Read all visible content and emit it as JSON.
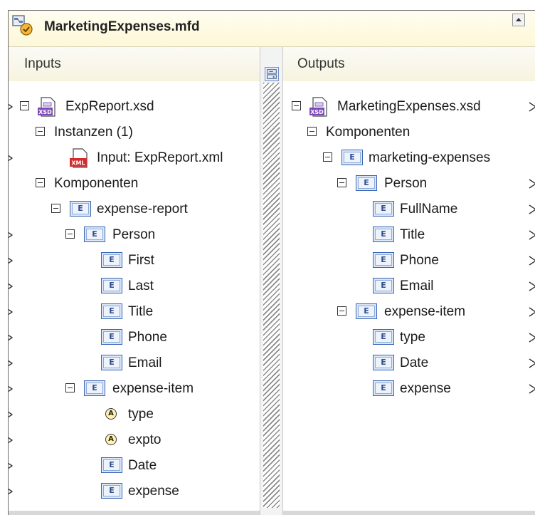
{
  "window": {
    "title": "MarketingExpenses.mfd"
  },
  "inputs": {
    "header": "Inputs",
    "schema": "ExpReport.xsd",
    "instances_label": "Instanzen (1)",
    "instance_file": "Input: ExpReport.xml",
    "components_label": "Komponenten",
    "root_element": "expense-report",
    "person": "Person",
    "person_fields": [
      "First",
      "Last",
      "Title",
      "Phone",
      "Email"
    ],
    "item": "expense-item",
    "item_attributes": [
      "type",
      "expto"
    ],
    "item_elements": [
      "Date",
      "expense"
    ]
  },
  "outputs": {
    "header": "Outputs",
    "schema": "MarketingExpenses.xsd",
    "components_label": "Komponenten",
    "root_element": "marketing-expenses",
    "person": "Person",
    "person_fields": [
      "FullName",
      "Title",
      "Phone",
      "Email"
    ],
    "item": "expense-item",
    "item_elements": [
      "type",
      "Date",
      "expense"
    ]
  },
  "icons": {
    "element_badge": "E",
    "attribute_badge": "A",
    "xsd_badge": "XSD",
    "xml_badge": "XML"
  }
}
